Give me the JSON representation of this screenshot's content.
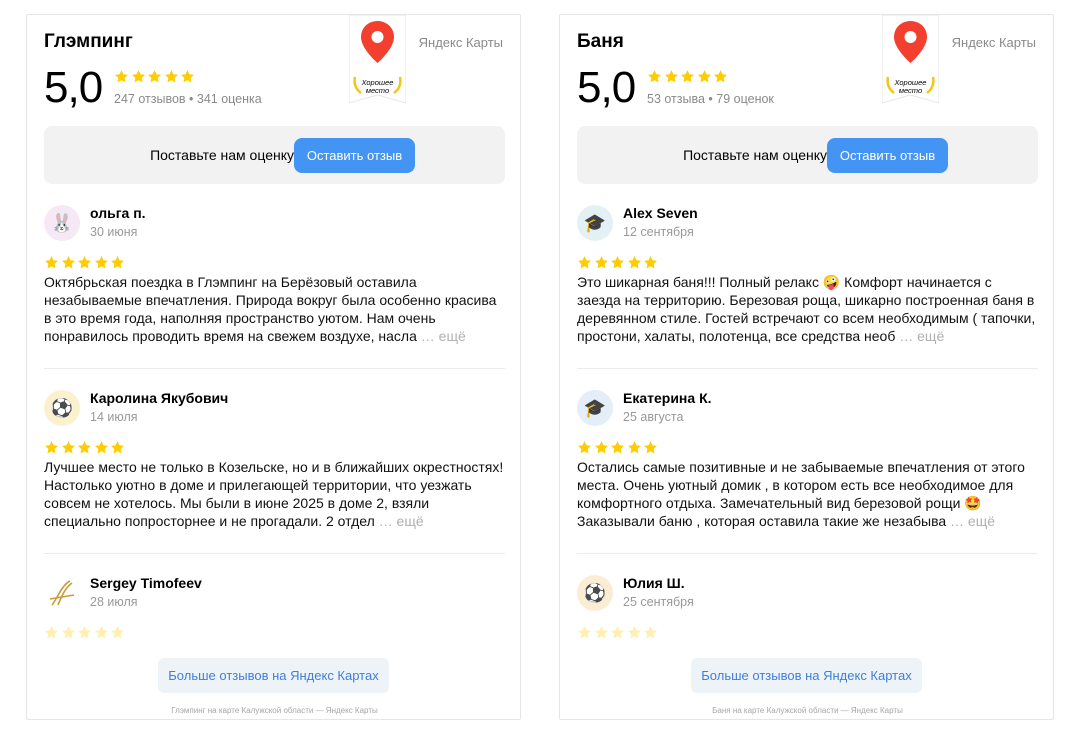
{
  "colors": {
    "accent": "#4494f4",
    "star": "#ffcc00",
    "pin": "#f33f2e",
    "laurel": "#f5c518"
  },
  "widgets": [
    {
      "title": "Глэмпинг",
      "brand": "Яндекс Карты",
      "badge_text_1": "Хорошее",
      "badge_text_2": "место",
      "rating": "5,0",
      "rating_stars": 5,
      "counts": "247 отзывов • 341 оценка",
      "cta_text": "Поставьте нам оценку",
      "cta_button": "Оставить отзыв",
      "reviews": [
        {
          "avatar_icon": "bunny-icon",
          "avatar_glyph": "🐰",
          "avatar_bg": "#f6e8f5",
          "name": "ольга п.",
          "date": "30 июня",
          "stars": 5,
          "text": "Октябрьская поездка в Глэмпинг на Берёзовый оставила незабываемые впечатления. Природа вокруг была особенно красива в это время года, наполняя пространство уютом. Нам очень понравилось проводить время на свежем воздухе, насла",
          "more": " … ещё"
        },
        {
          "avatar_icon": "soccer-ball-icon",
          "avatar_glyph": "⚽",
          "avatar_bg": "#fbf1cf",
          "name": "Каролина Якубович",
          "date": "14 июля",
          "stars": 5,
          "text": "Лучшее место не только в Козельске, но и в ближайших окрестностях! Настолько уютно в доме и прилегающей территории, что уезжать совсем не хотелось. Мы были в июне 2025 в доме 2, взяли специально попросторнее и не прогадали. 2 отдел",
          "more": " … ещё"
        },
        {
          "avatar_icon": "signature-logo-icon",
          "avatar_glyph": "⟆",
          "avatar_bg": "#ffffff",
          "name": "Sergey Timofeev",
          "date": "28 июля",
          "stars": 5,
          "text": "",
          "more": ""
        }
      ],
      "more_button": "Больше отзывов на Яндекс Картах",
      "footer": "Глэмпинг на карте Калужской области — Яндекс Карты"
    },
    {
      "title": "Баня",
      "brand": "Яндекс Карты",
      "badge_text_1": "Хорошее",
      "badge_text_2": "место",
      "rating": "5,0",
      "rating_stars": 5,
      "counts": "53 отзыва • 79 оценок",
      "cta_text": "Поставьте нам оценку",
      "cta_button": "Оставить отзыв",
      "reviews": [
        {
          "avatar_icon": "graduation-cap-icon",
          "avatar_glyph": "🎓",
          "avatar_bg": "#e3f1f5",
          "name": "Alex Seven",
          "date": "12 сентября",
          "stars": 5,
          "text": "Это шикарная баня!!! Полный релакс 🤪 Комфорт начинается с заезда на территорию. Березовая роща, шикарно построенная баня в деревянном стиле. Гостей встречают со всем необходимым ( тапочки, простони, халаты, полотенца, все средства необ",
          "more": " … ещё"
        },
        {
          "avatar_icon": "graduation-cap-icon",
          "avatar_glyph": "🎓",
          "avatar_bg": "#e3eef8",
          "name": "Екатерина К.",
          "date": "25 августа",
          "stars": 5,
          "text": "Остались самые позитивные и не забываемые впечатления от этого места. Очень уютный домик , в котором есть все необходимое для комфортного отдыха. Замечательный вид березовой рощи 🤩 Заказывали баню , которая оставила такие же незабыва",
          "more": " … ещё"
        },
        {
          "avatar_icon": "soccer-ball-icon",
          "avatar_glyph": "⚽",
          "avatar_bg": "#fbecd4",
          "name": "Юлия Ш.",
          "date": "25 сентября",
          "stars": 5,
          "text": "",
          "more": ""
        }
      ],
      "more_button": "Больше отзывов на Яндекс Картах",
      "footer": "Баня на карте Калужской области — Яндекс Карты"
    }
  ]
}
